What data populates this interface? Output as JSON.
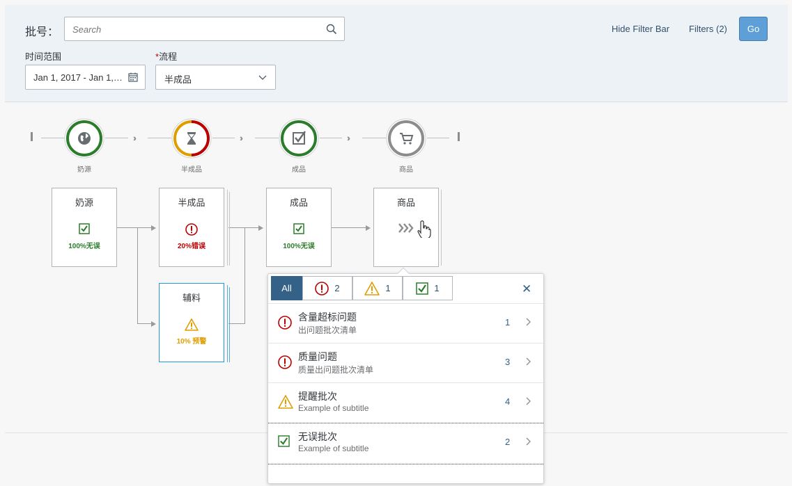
{
  "filterbar": {
    "batch_label": "批号：",
    "search_placeholder": "Search",
    "time_range_label": "时间范围",
    "date_value": "Jan 1, 2017 - Jan 1, 2018",
    "process_required": "*",
    "process_label": "流程",
    "process_value": "半成品",
    "hide_filter_bar": "Hide Filter Bar",
    "filters": "Filters (2)",
    "go": "Go"
  },
  "lanes": [
    {
      "label": "奶源",
      "icon": "globe-icon",
      "status_color": "#2b7d2b"
    },
    {
      "label": "半成品",
      "icon": "hourglass-icon",
      "status_color": "#e09d00"
    },
    {
      "label": "成品",
      "icon": "checklist-icon",
      "status_color": "#2b7d2b"
    },
    {
      "label": "商品",
      "icon": "cart-icon",
      "status_color": "#8c8c8c"
    }
  ],
  "nodes": {
    "milk": {
      "title": "奶源",
      "status": "100%无误",
      "icon": "check-icon"
    },
    "semi": {
      "title": "半成品",
      "status": "20%错误",
      "icon": "error-icon"
    },
    "aux": {
      "title": "辅料",
      "status": "10% 预警",
      "icon": "warning-icon"
    },
    "finished": {
      "title": "成品",
      "status": "100%无误",
      "icon": "check-icon"
    },
    "goods": {
      "title": "商品",
      "icon": "chevrons-icon"
    }
  },
  "colors": {
    "success": "#2b7d2b",
    "error": "#bb0000",
    "warning": "#e09d00",
    "accent": "#346187"
  },
  "popover": {
    "tabs": [
      {
        "label": "All"
      },
      {
        "count": "2",
        "icon": "error-icon"
      },
      {
        "count": "1",
        "icon": "warning-icon"
      },
      {
        "count": "1",
        "icon": "check-icon"
      }
    ],
    "items": [
      {
        "title": "含量超标问题",
        "subtitle": "出问题批次清单",
        "count": "1",
        "icon": "error-icon"
      },
      {
        "title": "质量问题",
        "subtitle": "质量出问题批次清单",
        "count": "3",
        "icon": "error-icon"
      },
      {
        "title": "提醒批次",
        "subtitle": "Example of subtitle",
        "count": "4",
        "icon": "warning-icon"
      },
      {
        "title": "无误批次",
        "subtitle": "Example of subtitle",
        "count": "2",
        "icon": "check-icon"
      }
    ]
  }
}
